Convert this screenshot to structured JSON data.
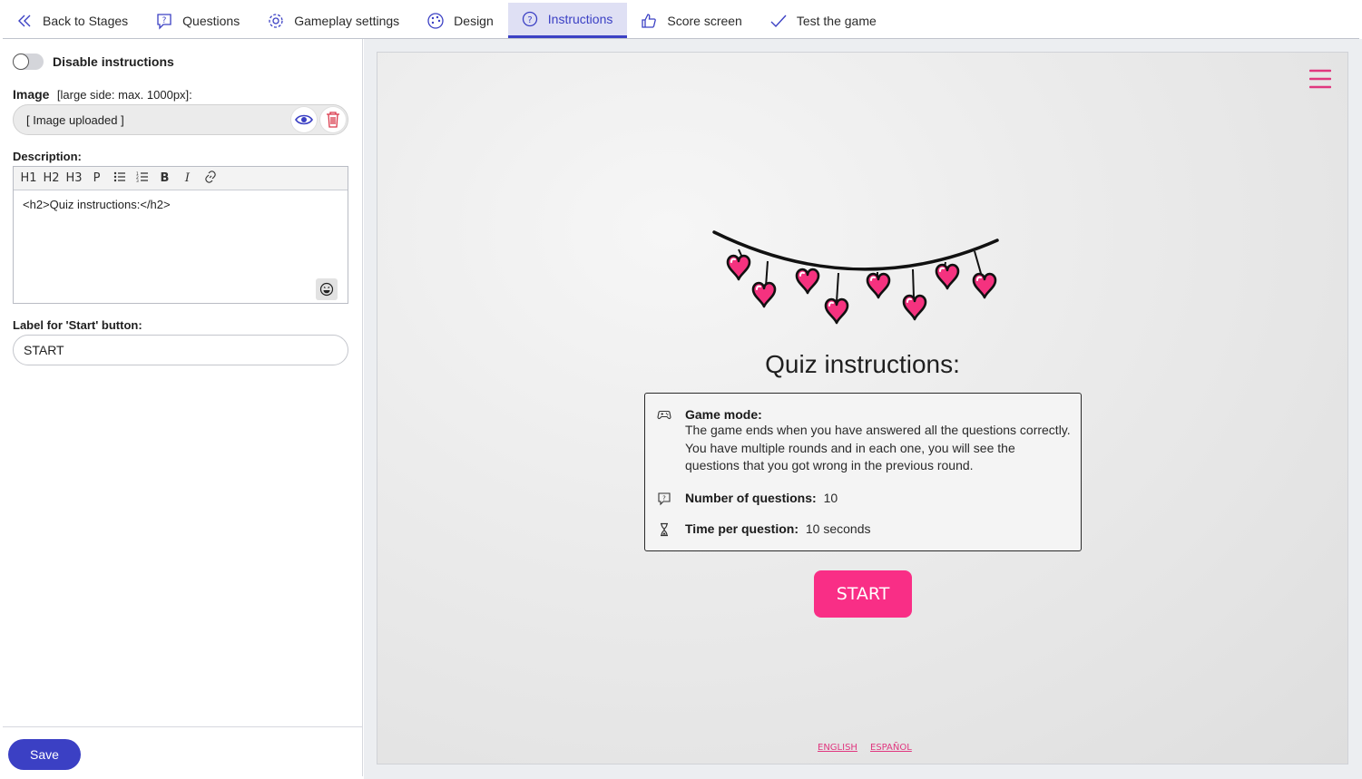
{
  "nav": {
    "items": [
      {
        "label": "Back to Stages",
        "icon": "chevron-double-left-icon"
      },
      {
        "label": "Questions",
        "icon": "question-bubble-icon"
      },
      {
        "label": "Gameplay settings",
        "icon": "gear-icon"
      },
      {
        "label": "Design",
        "icon": "palette-icon"
      },
      {
        "label": "Instructions",
        "icon": "help-circle-icon",
        "active": true
      },
      {
        "label": "Score screen",
        "icon": "thumbs-up-icon"
      },
      {
        "label": "Test the game",
        "icon": "checkmark-icon"
      }
    ]
  },
  "left": {
    "disable_label": "Disable instructions",
    "disable_on": false,
    "image_label": "Image",
    "image_hint": "[large side: max. 1000px]:",
    "image_value": "[ Image uploaded ]",
    "description_label": "Description:",
    "toolbar": [
      "H1",
      "H2",
      "H3",
      "P"
    ],
    "description_value": "<h2>Quiz instructions:</h2>",
    "start_label_title": "Label for 'Start' button:",
    "start_label_value": "START",
    "save_label": "Save"
  },
  "preview": {
    "title": "Quiz instructions:",
    "game_mode_label": "Game mode:",
    "game_mode_text": "The game ends when you have answered all the questions correctly. You have multiple rounds and in each one, you will see the questions that you got wrong in the previous round.",
    "num_questions_label": "Number of questions:",
    "num_questions_value": "10",
    "time_label": "Time per question:",
    "time_value": "10 seconds",
    "start_button": "START",
    "languages": [
      "ENGLISH",
      "ESPAÑOL"
    ]
  },
  "colors": {
    "accent": "#3b40c4",
    "active_tab_bg": "#dfe0f4",
    "start_pink": "#f92e86",
    "delete_red": "#d9384a"
  }
}
